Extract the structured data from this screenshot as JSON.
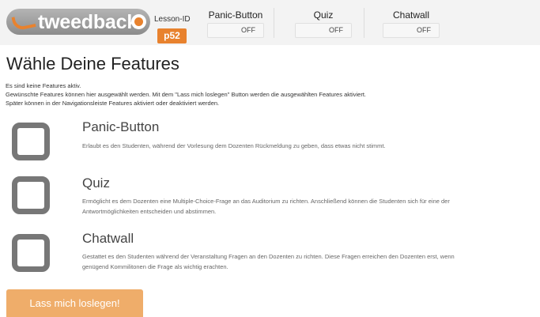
{
  "header": {
    "logo_text": "tweedback",
    "lesson_label": "Lesson-ID",
    "lesson_id": "p52",
    "toggles": [
      {
        "title": "Panic-Button",
        "state": "OFF"
      },
      {
        "title": "Quiz",
        "state": "OFF"
      },
      {
        "title": "Chatwall",
        "state": "OFF"
      }
    ]
  },
  "main": {
    "title": "Wähle Deine Features",
    "intro": [
      "Es sind keine Features aktiv.",
      "Gewünschte Features können hier ausgewählt werden. Mit dem \"Lass mich loslegen\" Button werden die ausgewählten Features aktiviert.",
      "Später können in der Navigationsleiste Features aktiviert oder deaktiviert werden."
    ],
    "features": [
      {
        "title": "Panic-Button",
        "desc": [
          "Erlaubt es den Studenten, während der Vorlesung dem Dozenten Rückmeldung zu geben, dass etwas nicht stimmt."
        ]
      },
      {
        "title": "Quiz",
        "desc": [
          "Ermöglicht es dem Dozenten eine Multiple-Choice-Frage an das Auditorium zu richten. Anschließend können die Studenten sich für eine der",
          "Antwortmöglichkeiten entscheiden und abstimmen."
        ]
      },
      {
        "title": "Chatwall",
        "desc": [
          "Gestattet es den Studenten während der Veranstaltung Fragen an den Dozenten zu richten. Diese Fragen erreichen den Dozenten erst, wenn",
          "genügend Kommilitonen die Frage als wichtig erachten."
        ]
      }
    ],
    "start_button": "Lass mich loslegen!"
  },
  "colors": {
    "accent": "#e8822e",
    "button": "#efad6a",
    "checkbox_border": "#777777"
  }
}
